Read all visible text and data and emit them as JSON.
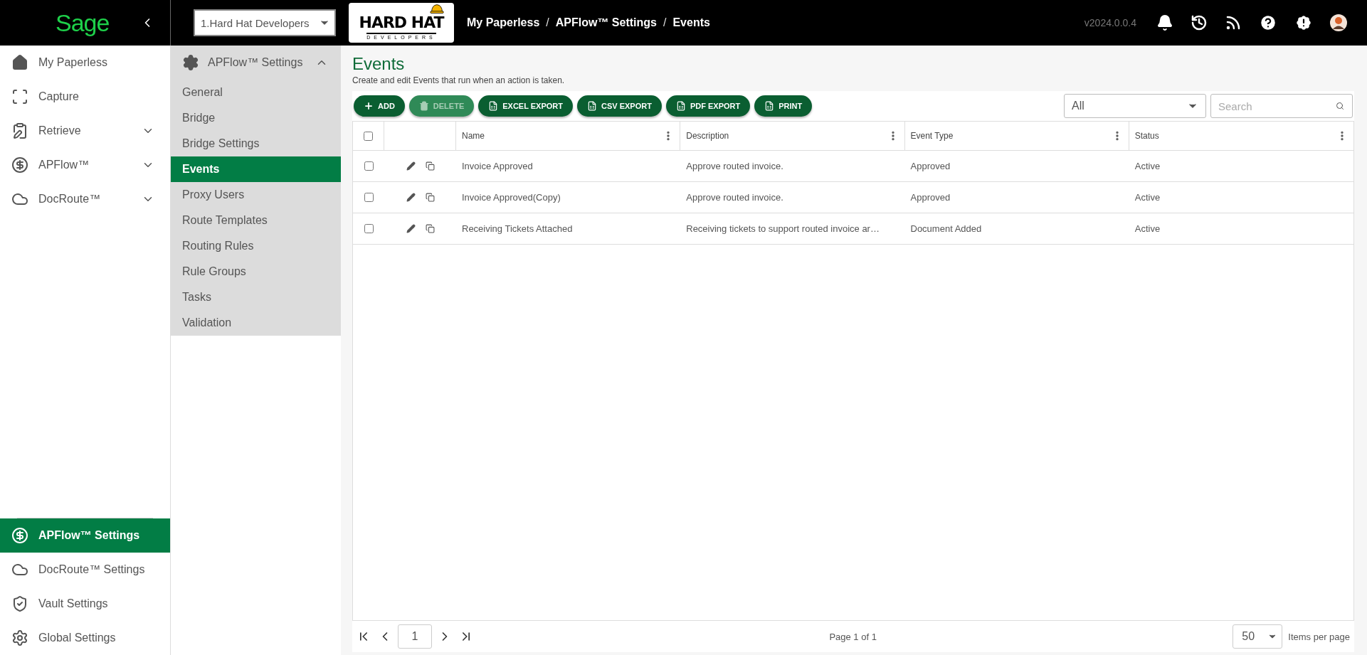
{
  "header": {
    "logo": "Sage",
    "company_select": {
      "value": "1.Hard Hat Developers"
    },
    "brand": {
      "line_1": "HARD HAT",
      "line_2": "DEVELOPERS"
    },
    "breadcrumbs": [
      {
        "kind": "link",
        "text": "My Paperless"
      },
      {
        "kind": "separator",
        "text": "/"
      },
      {
        "kind": "link",
        "text": "APFlow™ Settings"
      },
      {
        "kind": "separator",
        "text": "/"
      },
      {
        "kind": "link",
        "text": "Events"
      }
    ],
    "version": "v2024.0.0.4"
  },
  "sidebar": {
    "items": [
      {
        "label": "My Paperless",
        "kind": "link",
        "selected": false
      },
      {
        "label": "Capture",
        "kind": "link",
        "selected": false
      },
      {
        "label": "Retrieve",
        "kind": "group",
        "expanded": false,
        "selected": false
      },
      {
        "label": "APFlow™",
        "kind": "group",
        "expanded": false,
        "selected": false
      },
      {
        "label": "DocRoute™",
        "kind": "group",
        "expanded": false,
        "selected": false
      }
    ],
    "settings_items": [
      {
        "label": "APFlow™ Settings",
        "selected": true
      },
      {
        "label": "DocRoute™ Settings",
        "selected": false
      },
      {
        "label": "Vault Settings",
        "selected": false
      },
      {
        "label": "Global Settings",
        "selected": false
      }
    ]
  },
  "subnav": {
    "title": "APFlow™ Settings",
    "expanded": true,
    "items": [
      {
        "label": "General",
        "selected": false
      },
      {
        "label": "Bridge",
        "selected": false
      },
      {
        "label": "Bridge Settings",
        "selected": false
      },
      {
        "label": "Events",
        "selected": true
      },
      {
        "label": "Proxy Users",
        "selected": false
      },
      {
        "label": "Route Templates",
        "selected": false
      },
      {
        "label": "Routing Rules",
        "selected": false
      },
      {
        "label": "Rule Groups",
        "selected": false
      },
      {
        "label": "Tasks",
        "selected": false
      },
      {
        "label": "Validation",
        "selected": false
      }
    ]
  },
  "page": {
    "title": "Events",
    "subtitle": "Create and edit Events that run when an action is taken.",
    "toolbar": [
      {
        "label": "ADD",
        "kind": "add",
        "disabled": false
      },
      {
        "label": "DELETE",
        "kind": "delete",
        "disabled": true
      },
      {
        "label": "EXCEL EXPORT",
        "kind": "export",
        "disabled": false
      },
      {
        "label": "CSV EXPORT",
        "kind": "export",
        "disabled": false
      },
      {
        "label": "PDF EXPORT",
        "kind": "export",
        "disabled": false
      },
      {
        "label": "PRINT",
        "kind": "export",
        "disabled": false
      }
    ],
    "filter": {
      "value": "All"
    },
    "search": {
      "placeholder": "Search"
    }
  },
  "table": {
    "all_checked": false,
    "columns": [
      "Name",
      "Description",
      "Event Type",
      "Status"
    ],
    "rows": [
      {
        "name": "Invoice Approved",
        "description": "Approve routed invoice.",
        "event_type": "Approved",
        "status": "Active",
        "checked": false
      },
      {
        "name": "Invoice Approved(Copy)",
        "description": "Approve routed invoice.",
        "event_type": "Approved",
        "status": "Active",
        "checked": false
      },
      {
        "name": "Receiving Tickets Attached",
        "description": "Receiving tickets to support routed invoice ar…",
        "event_type": "Document Added",
        "status": "Active",
        "checked": false
      }
    ]
  },
  "pagination": {
    "page": "1",
    "page_info": "Page 1 of 1",
    "per_page": "50",
    "per_page_label": "Items per page"
  }
}
